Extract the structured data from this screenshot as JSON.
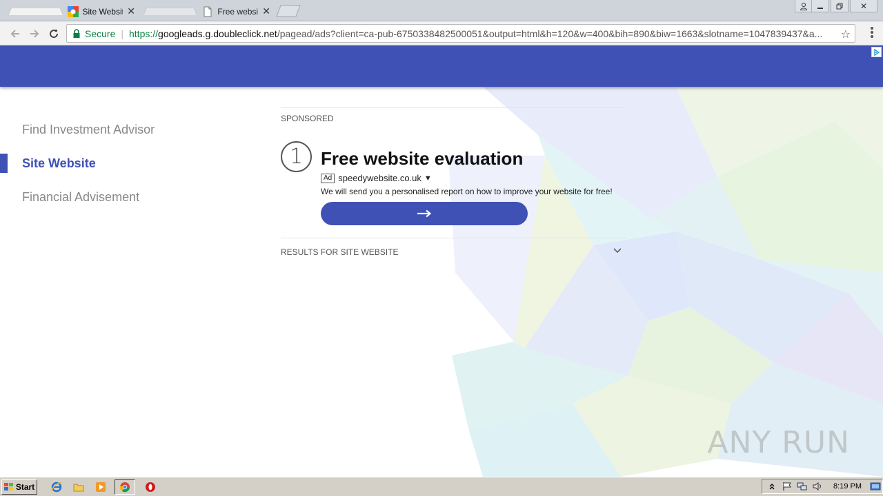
{
  "browser": {
    "tabs": [
      {
        "title": "Site Website - Ads by Google",
        "active": true
      },
      {
        "title": "Free website report - evaluation",
        "active": false
      }
    ],
    "address": {
      "secure_label": "Secure",
      "scheme": "https://",
      "host": "googleads.g.doubleclick.net",
      "path": "/pagead/ads?client=ca-pub-6750338482500051&output=html&h=120&w=400&bih=890&biw=1663&slotname=1047839437&a..."
    }
  },
  "sidebar": {
    "items": [
      {
        "label": "Find Investment Advisor"
      },
      {
        "label": "Site Website"
      },
      {
        "label": "Financial Advisement"
      }
    ]
  },
  "main": {
    "sponsored_label": "SPONSORED",
    "result": {
      "number": "1",
      "title": "Free website evaluation",
      "ad_badge": "Ad",
      "domain": "speedywebsite.co.uk",
      "domain_caret": "▼",
      "description": "We will send you a personalised report on how to improve your website for free!",
      "cta_icon": "arrow-right-icon"
    },
    "results_for_label": "RESULTS FOR SITE WEBSITE"
  },
  "watermark": "ANY RUN",
  "taskbar": {
    "start_label": "Start",
    "clock": "8:19 PM"
  },
  "colors": {
    "brand": "#3f51b5",
    "secure": "#0b8043",
    "taskbar": "#d4d0c8"
  }
}
